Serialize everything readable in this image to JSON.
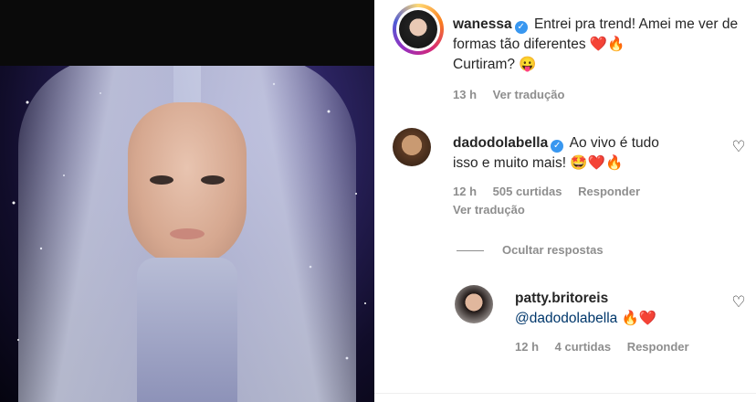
{
  "post": {
    "author": "wanessa",
    "caption": "Entrei pra trend! Amei me ver de formas tão diferentes",
    "caption_line2": "Curtiram?",
    "caption_emojis": "❤️🔥",
    "caption_emoji2": "😛",
    "time": "13 h",
    "translate": "Ver tradução"
  },
  "comments": [
    {
      "author": "dadodolabella",
      "text": "Ao vivo é tudo",
      "text2": "isso e muito mais!",
      "emojis": "🤩❤️🔥",
      "time": "12 h",
      "likes": "505 curtidas",
      "reply": "Responder",
      "translate": "Ver tradução",
      "hide_replies": "Ocultar respostas",
      "replies": [
        {
          "author": "patty.britoreis",
          "mention": "@dadodolabella",
          "emojis": "🔥❤️",
          "time": "12 h",
          "likes": "4 curtidas",
          "reply": "Responder"
        }
      ]
    }
  ],
  "icons": {
    "verified": "✓",
    "heart": "♡"
  }
}
